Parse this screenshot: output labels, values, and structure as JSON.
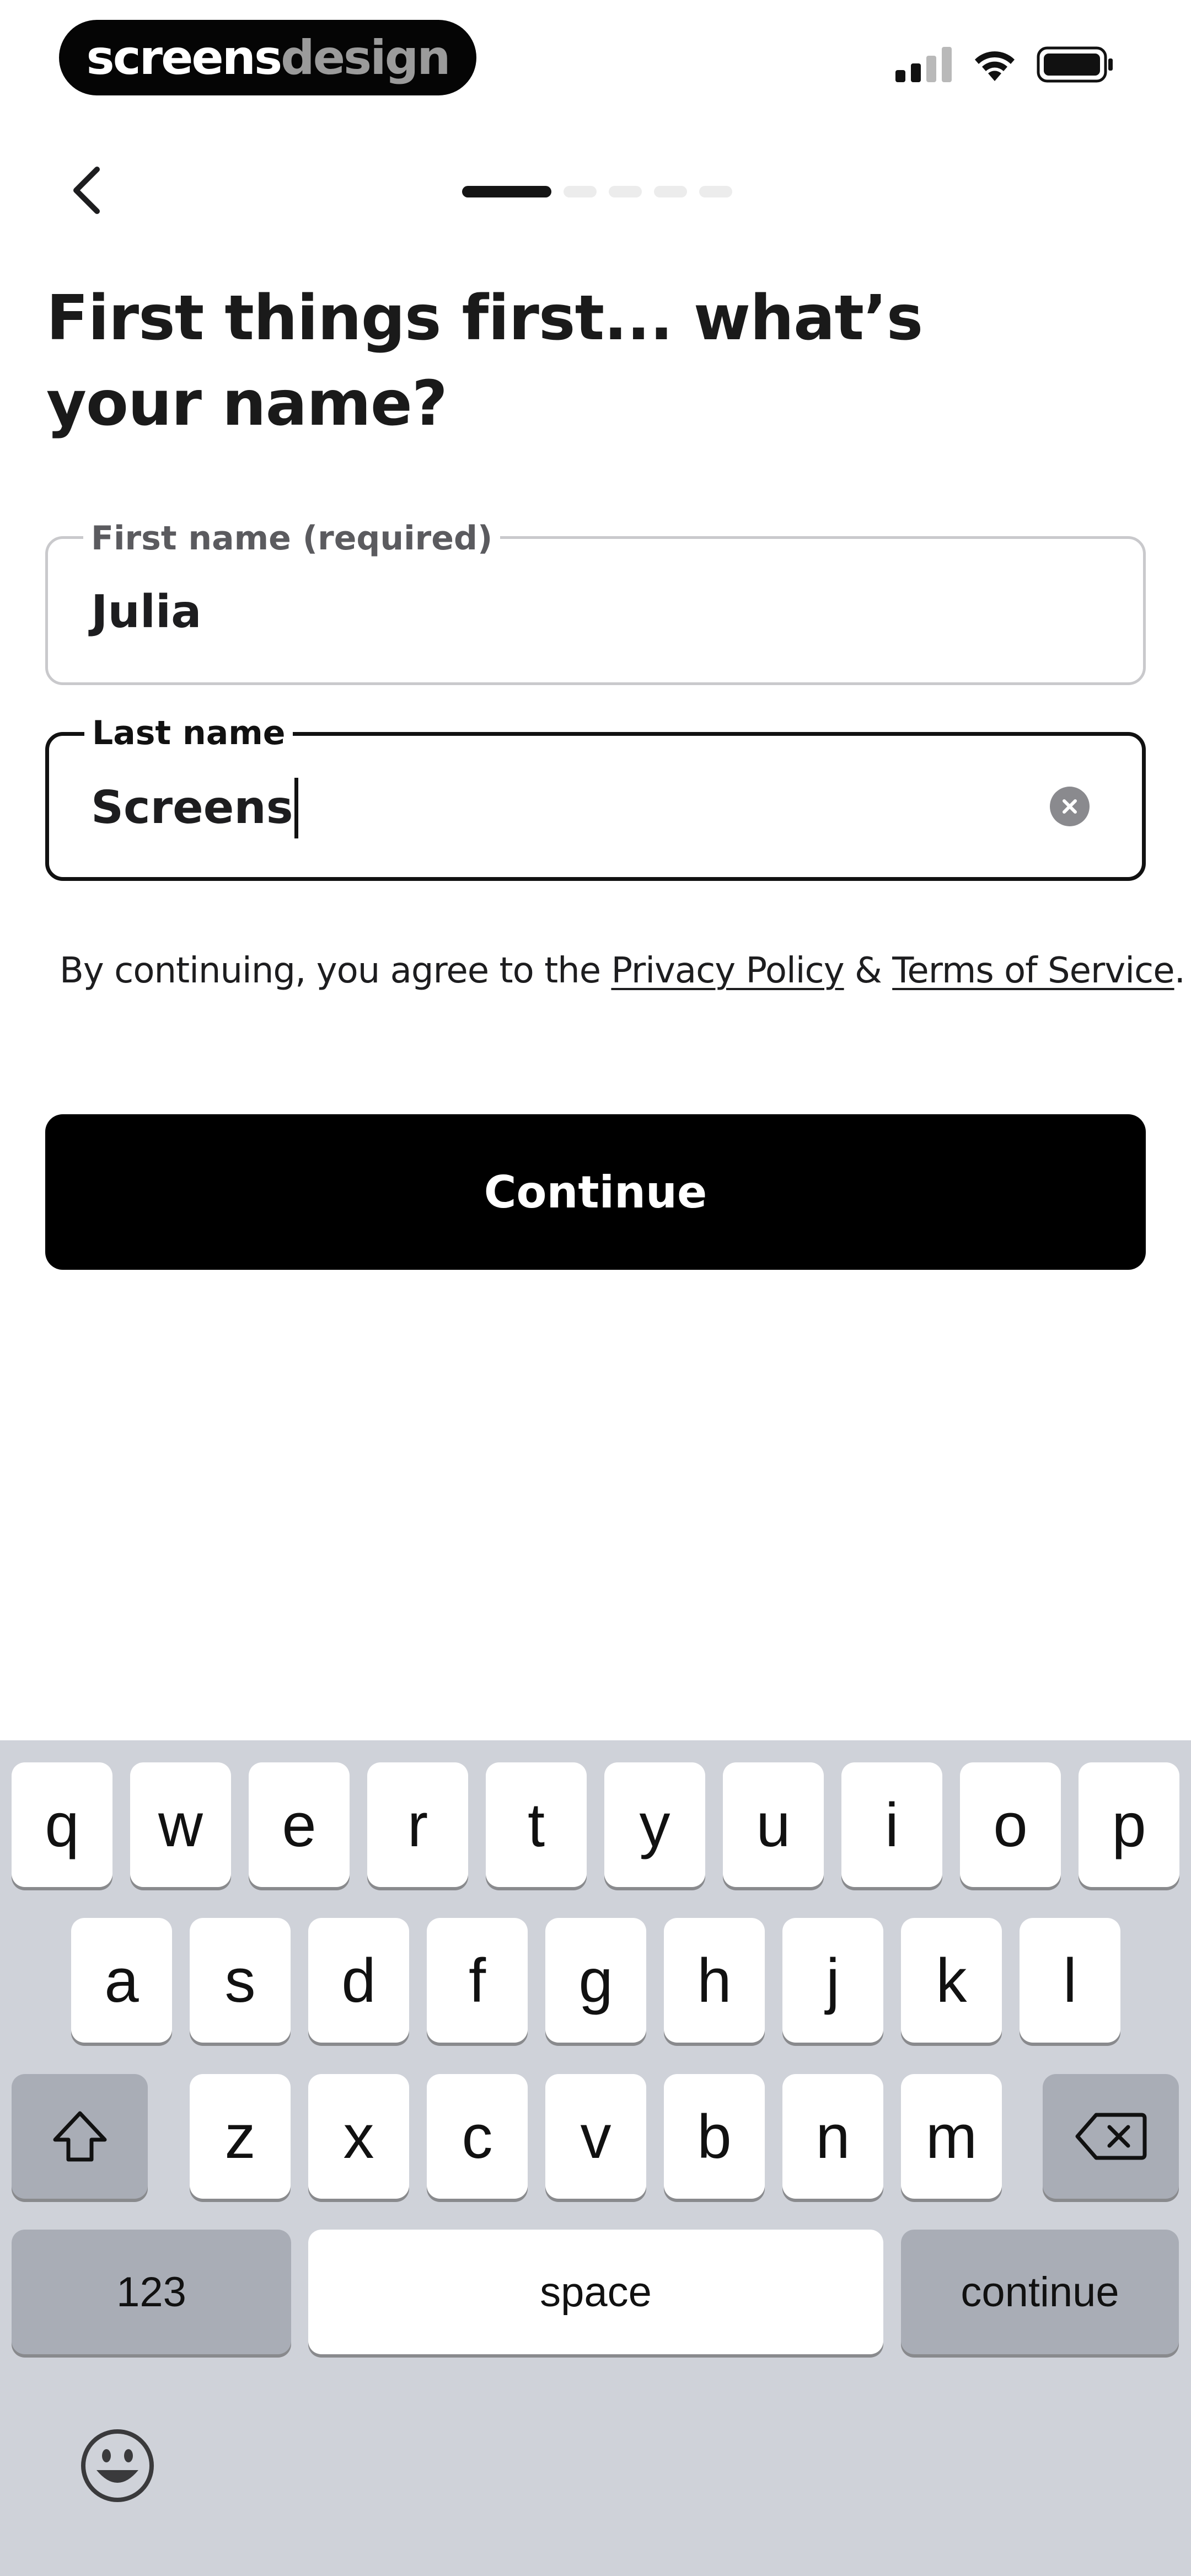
{
  "status_bar": {
    "brand_part1": "screens",
    "brand_part2": "design",
    "icons": [
      "cellular-signal-icon",
      "wifi-icon",
      "battery-icon"
    ]
  },
  "nav": {
    "back_icon": "chevron-left-icon",
    "progress": {
      "current_step": 1,
      "total_steps": 5
    }
  },
  "title": "First things first... what’s your name?",
  "fields": {
    "first_name": {
      "label": "First name (required)",
      "value": "Julia"
    },
    "last_name": {
      "label": "Last name",
      "value": "Screens",
      "clear_icon": "clear-circle-icon"
    }
  },
  "terms": {
    "prefix": "By continuing, you agree to the ",
    "privacy_link": "Privacy Policy",
    "separator": " & ",
    "terms_link": "Terms of Service",
    "suffix": "."
  },
  "continue_label": "Continue",
  "keyboard": {
    "row1": [
      "q",
      "w",
      "e",
      "r",
      "t",
      "y",
      "u",
      "i",
      "o",
      "p"
    ],
    "row2": [
      "a",
      "s",
      "d",
      "f",
      "g",
      "h",
      "j",
      "k",
      "l"
    ],
    "row3": [
      "z",
      "x",
      "c",
      "v",
      "b",
      "n",
      "m"
    ],
    "shift_icon": "shift-arrow-icon",
    "delete_icon": "backspace-icon",
    "numbers_label": "123",
    "space_label": "space",
    "return_label": "continue",
    "emoji_icon": "emoji-face-icon"
  },
  "colors": {
    "accent": "#000000",
    "keyboard_bg": "#cfd2d9",
    "field_border": "#c9c9cc"
  }
}
